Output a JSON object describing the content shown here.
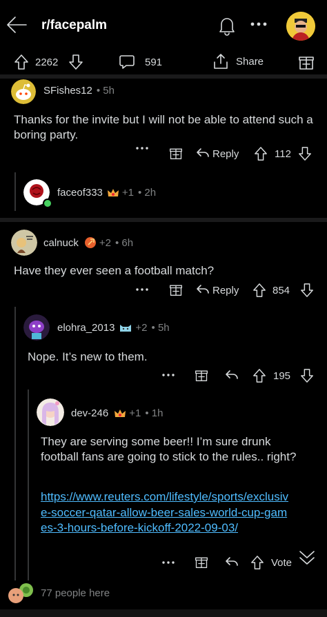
{
  "header": {
    "subreddit": "r/facepalm"
  },
  "post_bar": {
    "upvotes": "2262",
    "comments": "591",
    "share_label": "Share"
  },
  "comments": [
    {
      "author": "SFishes12",
      "meta": "• 5h",
      "body": "Thanks for the invite but I will not be able to attend such a boring party.",
      "reply_label": "Reply",
      "score": "112"
    },
    {
      "author": "faceof333",
      "awards": "+1",
      "meta": "• 2h"
    },
    {
      "author": "calnuck",
      "awards": "+2",
      "meta": "• 6h",
      "body": "Have they ever seen a football match?",
      "reply_label": "Reply",
      "score": "854"
    },
    {
      "author": "elohra_2013",
      "awards": "+2",
      "meta": "• 5h",
      "body": "Nope. It’s new to them.",
      "score": "195"
    },
    {
      "author": "dev-246",
      "awards": "+1",
      "meta": "• 1h",
      "body": "They are serving some beer!! I’m sure drunk football fans are going to stick to the rules.. right?",
      "link": "https://www.reuters.com/lifestyle/sports/exclusive-soccer-qatar-allow-beer-sales-world-cup-games-3-hours-before-kickoff-2022-09-03/",
      "vote_label": "Vote"
    }
  ],
  "presence": {
    "text": "77 people here"
  },
  "colors": {
    "background": "#000000",
    "text": "#d7dadc",
    "muted": "#818384",
    "link": "#4fbcff",
    "online": "#46d160"
  }
}
